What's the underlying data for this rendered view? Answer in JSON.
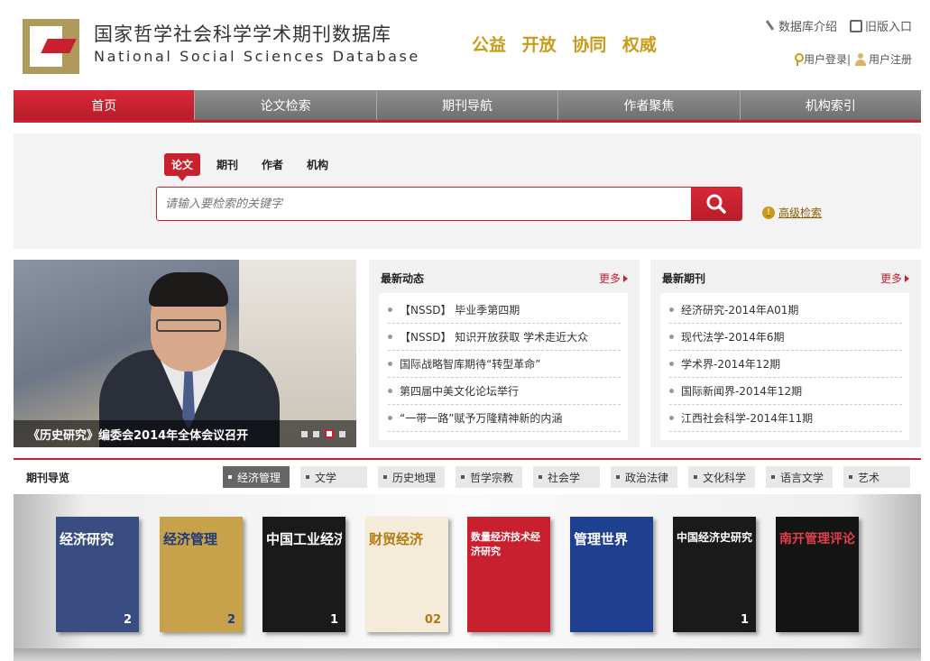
{
  "header": {
    "title_cn": "国家哲学社会科学学术期刊数据库",
    "title_en": "National Social Sciences Database",
    "slogan": [
      "公益",
      "开放",
      "协同",
      "权威"
    ],
    "links": {
      "intro": "数据库介绍",
      "old": "旧版入口",
      "login": "用户登录|",
      "register": "用户注册"
    }
  },
  "nav": [
    "首页",
    "论文检索",
    "期刊导航",
    "作者聚焦",
    "机构索引"
  ],
  "search": {
    "tabs": [
      "论文",
      "期刊",
      "作者",
      "机构"
    ],
    "placeholder": "请输入要检索的关键字",
    "advanced": "高级检索"
  },
  "banner": {
    "caption": "《历史研究》编委会2014年全体会议召开"
  },
  "news": {
    "title": "最新动态",
    "more": "更多",
    "items": [
      "【NSSD】  毕业季第四期",
      "【NSSD】  知识开放获取 学术走近大众",
      "国际战略智库期待“转型革命”",
      "第四届中美文化论坛举行",
      "“一带一路”赋予万隆精神新的内涵"
    ]
  },
  "journals": {
    "title": "最新期刊",
    "more": "更多",
    "items": [
      "经济研究-2014年A01期",
      "现代法学-2014年6期",
      "学术界-2014年12期",
      "国际新闻界-2014年12期",
      "江西社会科学-2014年11期"
    ]
  },
  "journal_nav": {
    "title": "期刊导览",
    "categories": [
      "经济管理",
      "文学",
      "历史地理",
      "哲学宗教",
      "社会学",
      "政治法律",
      "文化科学",
      "语言文学",
      "艺术"
    ]
  },
  "covers": [
    {
      "title": "经济研究",
      "num": "2",
      "bg": "#3a4d82",
      "fg": "#ffffff"
    },
    {
      "title": "经济管理",
      "num": "2",
      "bg": "#c7a24a",
      "fg": "#1f3a7a"
    },
    {
      "title": "中国工业经济",
      "num": "1",
      "bg": "#1a1a1a",
      "fg": "#ffffff"
    },
    {
      "title": "财贸经济",
      "num": "02",
      "bg": "#f4ecd8",
      "fg": "#b47a12"
    },
    {
      "title": "数量经济技术经济研究",
      "num": "",
      "bg": "#c8202f",
      "fg": "#ffffff"
    },
    {
      "title": "管理世界",
      "num": "",
      "bg": "#1f3f8f",
      "fg": "#ffffff"
    },
    {
      "title": "中国经济史研究",
      "num": "1",
      "bg": "#1a1a1a",
      "fg": "#ffffff"
    },
    {
      "title": "南开管理评论",
      "num": "",
      "bg": "#141414",
      "fg": "#e0404a"
    }
  ]
}
